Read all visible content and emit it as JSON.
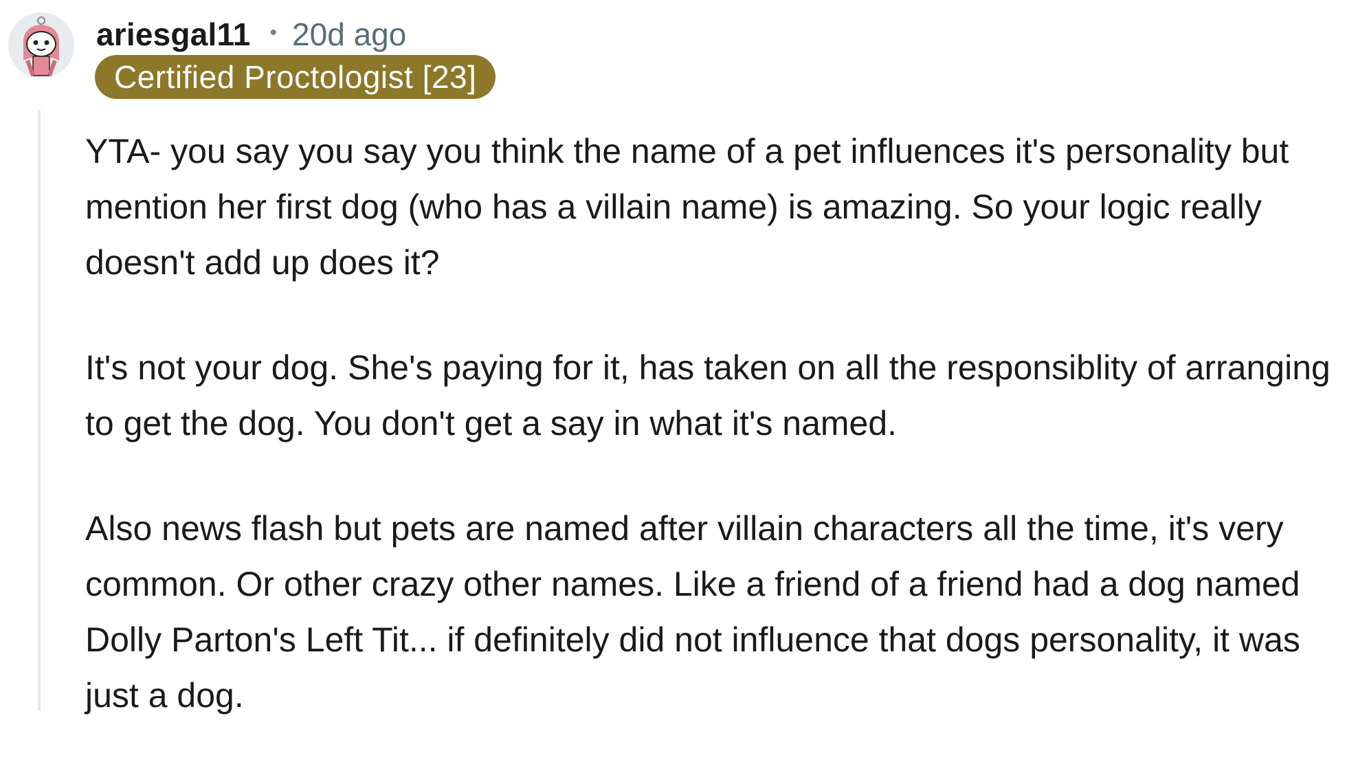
{
  "comment": {
    "author": "ariesgal11",
    "separator": "•",
    "age": "20d ago",
    "flair": "Certified Proctologist [23]",
    "paragraphs": [
      "YTA- you say you say you think the name of a pet influences it's personality but mention her first dog (who has a villain name) is amazing. So your logic really doesn't add up does it?",
      "It's not your dog. She's paying for it, has taken on all the responsiblity of arranging to get the dog. You don't get a say in what it's named.",
      "Also news flash but pets are named after villain characters all the time, it's very common. Or other crazy other names. Like a friend of a friend had a dog named Dolly Parton's Left Tit... if definitely did not influence that dogs personality, it was just a dog."
    ]
  },
  "colors": {
    "flair_background": "#8d7728",
    "flair_text": "#ffffff",
    "timestamp": "#576f76",
    "thread_line": "#e5e7ea"
  },
  "icons": {
    "avatar": "avatar-icon"
  }
}
